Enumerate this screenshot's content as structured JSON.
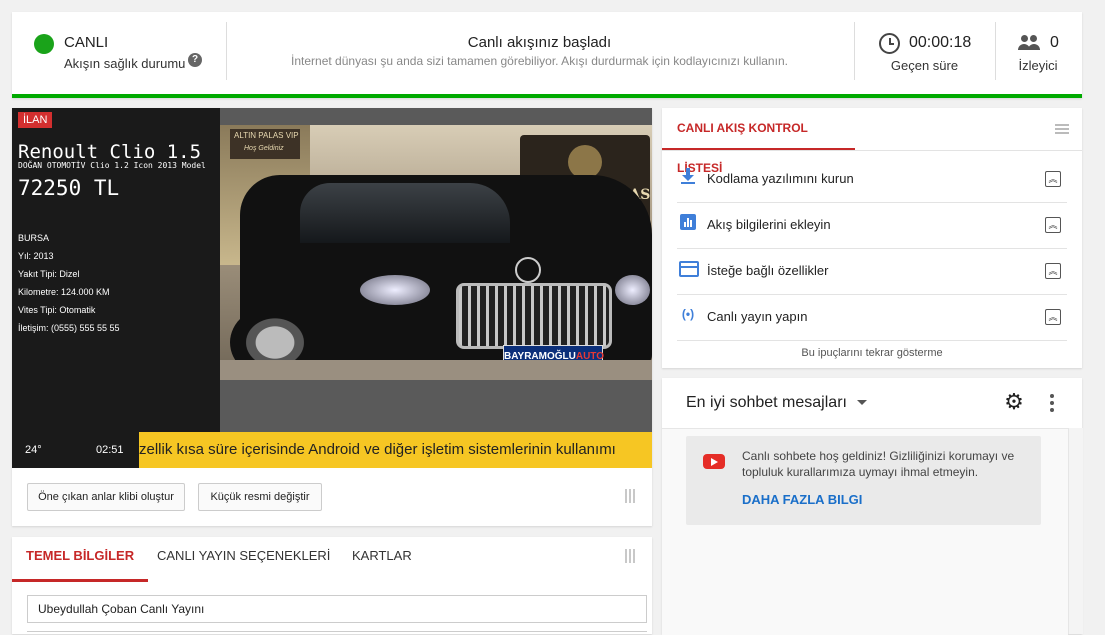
{
  "status": {
    "live_label": "CANLI",
    "health_label": "Akışın sağlık durumu",
    "title": "Canlı akışınız başladı",
    "subtitle": "İnternet dünyası şu anda sizi tamamen görebiliyor. Akışı durdurmak için kodlayıcınızı kullanın.",
    "elapsed_value": "00:00:18",
    "elapsed_label": "Geçen süre",
    "viewers_value": "0",
    "viewers_label": "İzleyici",
    "live_color": "#1aa31a"
  },
  "player": {
    "ad_badge": "İLAN",
    "car_title": "Renoult Clio 1.5",
    "car_subtitle": "DOĞAN OTOMOTİV Clio 1.2 Icon 2013 Model",
    "price": "72250 TL",
    "details": [
      "BURSA",
      "Yıl: 2013",
      "Yakıt Tipi: Dizel",
      "Kilometre: 124.000 KM",
      "Vites Tipi: Otomatik",
      "İletişim: (0555) 555 55 55"
    ],
    "temperature": "24°",
    "clock": "02:51",
    "ticker_text": "zellik kısa süre içerisinde Android ve diğer işletim sistemlerinin kullanımı",
    "photo_sign": "ALTIN PALAS",
    "photo_sign_small": "ALTIN PALAS VIP",
    "photo_welcome": "Hoş Geldiniz",
    "plate_text": "BAYRAMOĞLU",
    "plate_accent": "AUTO",
    "clip_button": "Öne çıkan anlar klibi oluştur",
    "thumb_button": "Küçük resmi değiştir"
  },
  "tabs": {
    "items": [
      "TEMEL BİLGİLER",
      "CANLI YAYIN SEÇENEKLERİ",
      "KARTLAR"
    ],
    "title_value": "Ubeydullah Çoban Canlı Yayını"
  },
  "checklist": {
    "header": "CANLI AKIŞ KONTROL LİSTESİ",
    "items": [
      {
        "label": "Kodlama yazılımını kurun",
        "icon": "download-icon"
      },
      {
        "label": "Akış bilgilerini ekleyin",
        "icon": "chart-icon"
      },
      {
        "label": "İsteğe bağlı özellikler",
        "icon": "card-icon"
      },
      {
        "label": "Canlı yayın yapın",
        "icon": "broadcast-icon"
      }
    ],
    "footer": "Bu ipuçlarını tekrar gösterme",
    "accent": "#c62828",
    "icon_color": "#3f7fd9"
  },
  "chat": {
    "title": "En iyi sohbet mesajları",
    "welcome": "Canlı sohbete hoş geldiniz! Gizliliğinizi korumayı ve topluluk kurallarımıza uymayı ihmal etmeyin.",
    "more_link": "DAHA FAZLA BILGI"
  }
}
